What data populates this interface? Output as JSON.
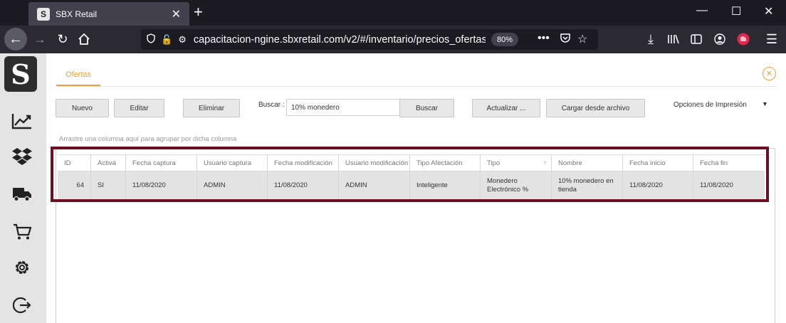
{
  "browser": {
    "tab_title": "SBX Retail",
    "tab_favicon": "S",
    "url": "capacitacion-ngine.sbxretail.com/v2/#/inventario/precios_ofertas/o",
    "zoom": "80%"
  },
  "app": {
    "logo": "S",
    "page_tab": "Ofertas",
    "toolbar": {
      "nuevo": "Nuevo",
      "editar": "Editar",
      "eliminar": "Eliminar",
      "buscar_label": "Buscar :",
      "search_value": "10% monedero",
      "buscar_button": "Buscar",
      "actualizar": "Actualizar ...",
      "cargar": "Cargar desde archivo",
      "print_options": "Opciones de Impresión"
    },
    "group_hint": "Arrastre una columna aquí para agrupar por dicha columna",
    "grid": {
      "columns": [
        "ID",
        "Activa",
        "Fecha captura",
        "Usuario captura",
        "Fecha modificación",
        "Usuario modificación",
        "Tipo Afectación",
        "Tipo",
        "Nombre",
        "Fecha inicio",
        "Fecha fin"
      ],
      "rows": [
        [
          "64",
          "SI",
          "11/08/2020",
          "ADMIN",
          "11/08/2020",
          "ADMIN",
          "Inteligente",
          "Monedero Electrónico %",
          "10% monedero en tienda",
          "11/08/2020",
          "11/08/2020"
        ]
      ]
    }
  },
  "colors": {
    "accent": "#e8a23d",
    "highlight": "#6e0f24"
  }
}
